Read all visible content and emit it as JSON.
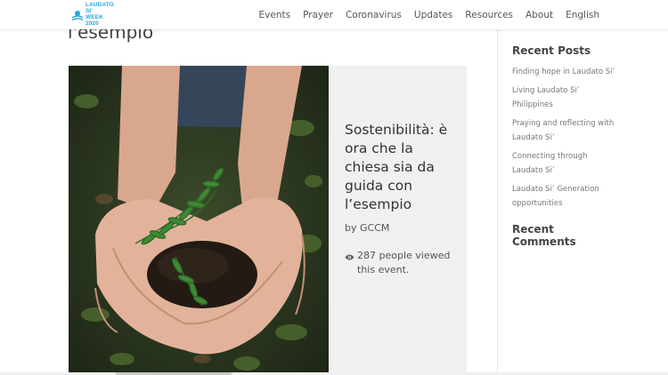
{
  "header": {
    "logo": {
      "line1": "LAUDATO SI'",
      "line2": "WEEK 2020"
    },
    "nav": [
      "Events",
      "Prayer",
      "Coronavirus",
      "Updates",
      "Resources",
      "About",
      "English"
    ]
  },
  "main": {
    "page_title": "l'esempio",
    "card": {
      "title": "Sostenibilità: è ora che la chiesa sia da guida con l’esempio",
      "author": "by GCCM",
      "views": "287 people viewed this event.",
      "image_alt": "hands holding soil with a small plant"
    }
  },
  "sidebar": {
    "recent_posts_heading": "Recent Posts",
    "recent_posts": [
      "Finding hope in Laudato Si’",
      "Living Laudato Si’ Philippines",
      "Praying and reflecting with Laudato Si’",
      "Connecting through Laudato Si’",
      "Laudato Si’ Generation opportunities"
    ],
    "recent_comments_heading": "Recent Comments"
  },
  "colors": {
    "brand": "#2aa6d9",
    "card_bg": "#f0f0f0"
  }
}
